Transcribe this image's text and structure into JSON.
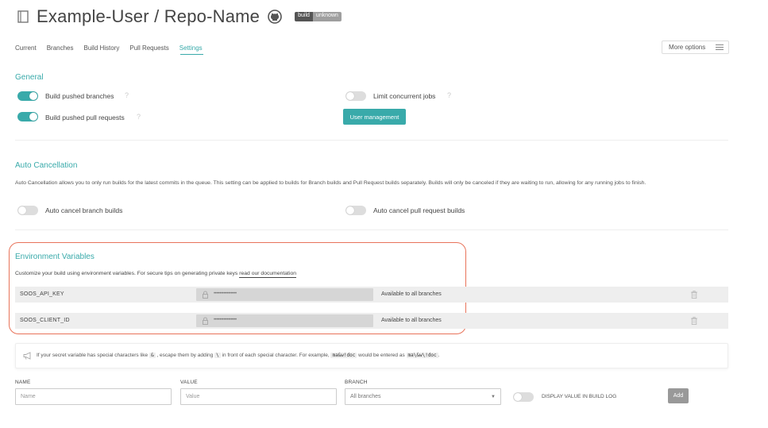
{
  "header": {
    "repo_title": "Example-User / Repo-Name",
    "badge_left": "build",
    "badge_right": "unknown"
  },
  "tabs": [
    {
      "label": "Current"
    },
    {
      "label": "Branches"
    },
    {
      "label": "Build History"
    },
    {
      "label": "Pull Requests"
    },
    {
      "label": "Settings",
      "active": true
    }
  ],
  "more_options": "More options",
  "general": {
    "title": "General",
    "build_pushed_branches": {
      "label": "Build pushed branches",
      "enabled": true
    },
    "build_pushed_prs": {
      "label": "Build pushed pull requests",
      "enabled": true
    },
    "limit_concurrent": {
      "label": "Limit concurrent jobs",
      "enabled": false
    },
    "user_management": "User management",
    "help": "?"
  },
  "auto_cancel": {
    "title": "Auto Cancellation",
    "description": "Auto Cancellation allows you to only run builds for the latest commits in the queue. This setting can be applied to builds for Branch builds and Pull Request builds separately. Builds will only be canceled if they are waiting to run, allowing for any running jobs to finish.",
    "branch_builds": {
      "label": "Auto cancel branch builds",
      "enabled": false
    },
    "pr_builds": {
      "label": "Auto cancel pull request builds",
      "enabled": false
    }
  },
  "env": {
    "title": "Environment Variables",
    "desc_prefix": "Customize your build using environment variables. For secure tips on generating private keys",
    "desc_link": "read our documentation",
    "rows": [
      {
        "name": "SOOS_API_KEY",
        "value": "••••••••••••••••",
        "branch": "Available to all branches"
      },
      {
        "name": "SOOS_CLIENT_ID",
        "value": "••••••••••••••••",
        "branch": "Available to all branches"
      }
    ],
    "note": {
      "p1": "If your secret variable has special characters like",
      "c1": "&",
      "p2": ", escape them by adding",
      "c2": "\\",
      "p3": "in front of each special character. For example,",
      "c3": "ma&w!doc",
      "p4": "would be entered as",
      "c4": "ma\\&w\\!doc",
      "p5": "."
    }
  },
  "form": {
    "name_label": "NAME",
    "name_placeholder": "Name",
    "value_label": "VALUE",
    "value_placeholder": "Value",
    "branch_label": "BRANCH",
    "branch_value": "All branches",
    "display_label": "DISPLAY VALUE IN BUILD LOG",
    "add_label": "Add"
  },
  "colors": {
    "accent": "#39aaaa",
    "highlight_border": "#e8735a"
  }
}
